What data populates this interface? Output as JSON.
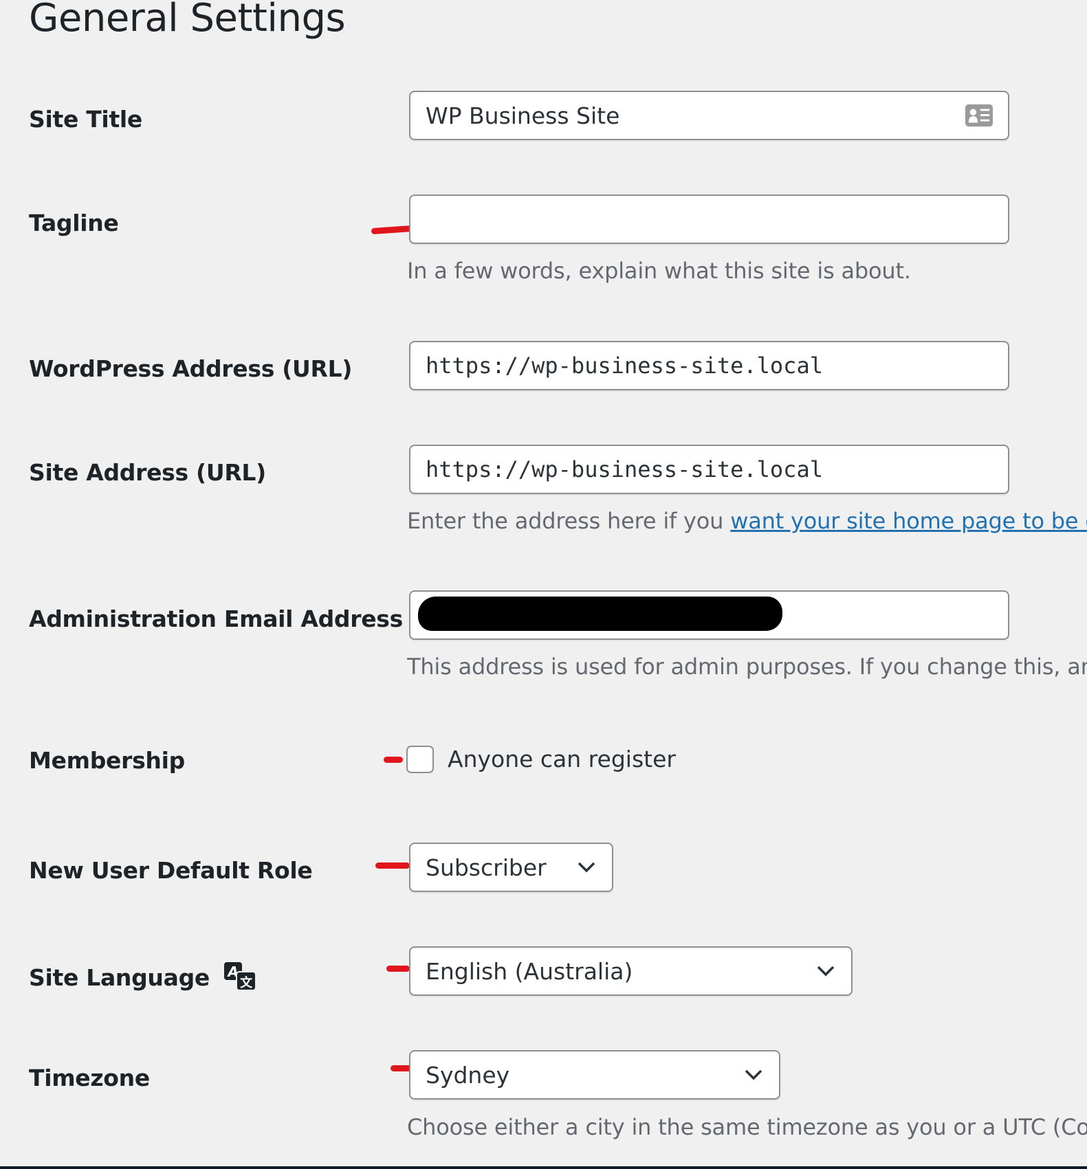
{
  "page": {
    "title": "General Settings"
  },
  "fields": {
    "site_title": {
      "label": "Site Title",
      "value": "WP Business Site",
      "icon": "contact-card-icon"
    },
    "tagline": {
      "label": "Tagline",
      "value": "",
      "description": "In a few words, explain what this site is about."
    },
    "wordpress_address": {
      "label": "WordPress Address (URL)",
      "value": "https://wp-business-site.local"
    },
    "site_address": {
      "label": "Site Address (URL)",
      "value": "https://wp-business-site.local",
      "description_prefix": "Enter the address here if you ",
      "description_link": "want your site home page to be different from your WordPress installation directory"
    },
    "admin_email": {
      "label": "Administration Email Address",
      "value": "[redacted]",
      "description": "This address is used for admin purposes. If you change this, an email will be sent to your new address to confirm it."
    },
    "membership": {
      "label": "Membership",
      "checkbox_label": "Anyone can register",
      "checked": false
    },
    "default_role": {
      "label": "New User Default Role",
      "selected": "Subscriber"
    },
    "site_language": {
      "label": "Site Language",
      "icon": "translate-icon",
      "selected": "English (Australia)"
    },
    "timezone": {
      "label": "Timezone",
      "selected": "Sydney",
      "description": "Choose either a city in the same timezone as you or a UTC (Coordinated Universal Time) time offset."
    }
  },
  "colors": {
    "background": "#f0f0f1",
    "link": "#2271b1",
    "annotation_marks": "#e0161c",
    "description_text": "#646970"
  }
}
